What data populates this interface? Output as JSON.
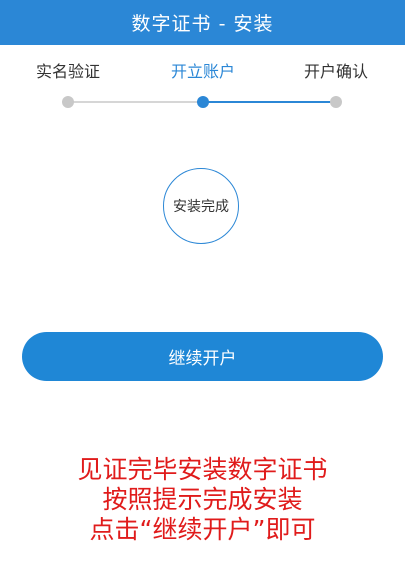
{
  "header": {
    "title": "数字证书 - 安装"
  },
  "steps": [
    {
      "label": "实名验证",
      "state": "done"
    },
    {
      "label": "开立账户",
      "state": "current"
    },
    {
      "label": "开户确认",
      "state": "pending"
    }
  ],
  "status": {
    "text": "安装完成"
  },
  "actions": {
    "continue_label": "继续开户"
  },
  "annotation": {
    "lines": [
      "见证完毕安装数字证书",
      "按照提示完成安装",
      "点击“继续开户”即可"
    ]
  },
  "colors": {
    "accent": "#2b87d6",
    "button": "#1f87d6",
    "track_inactive": "#d6d6d6",
    "dot_inactive": "#c8c8c8",
    "annotation": "#e01b1b"
  }
}
